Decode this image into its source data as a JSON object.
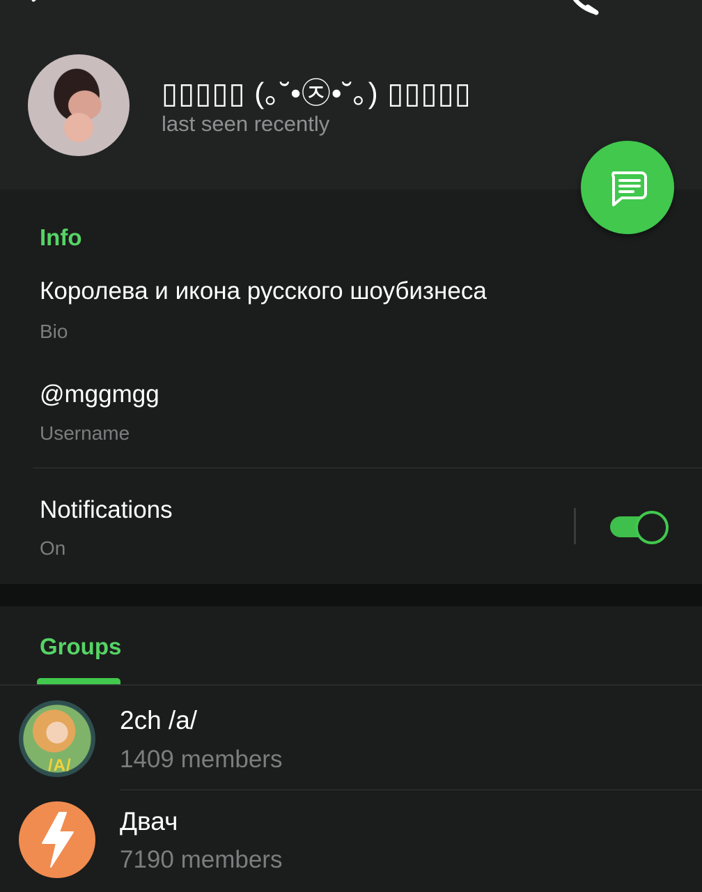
{
  "header": {
    "name": "▯▯▯▯▯ (｡˘•㉨•˘｡) ▯▯▯▯▯",
    "status": "last seen recently"
  },
  "info": {
    "section_title": "Info",
    "bio_value": "Королева и икона русского шоубизнеса",
    "bio_label": "Bio",
    "username_value": "@mggmgg",
    "username_label": "Username",
    "notifications_label": "Notifications",
    "notifications_value": "On",
    "notifications_enabled": true
  },
  "groups": {
    "tab_label": "Groups",
    "items": [
      {
        "name": "2ch /a/",
        "members": "1409 members",
        "avatar_badge": "/A/"
      },
      {
        "name": "Двач",
        "members": "7190 members"
      }
    ]
  },
  "colors": {
    "accent": "#41c84d",
    "background": "#1b1c1c",
    "header_background": "#212323"
  }
}
